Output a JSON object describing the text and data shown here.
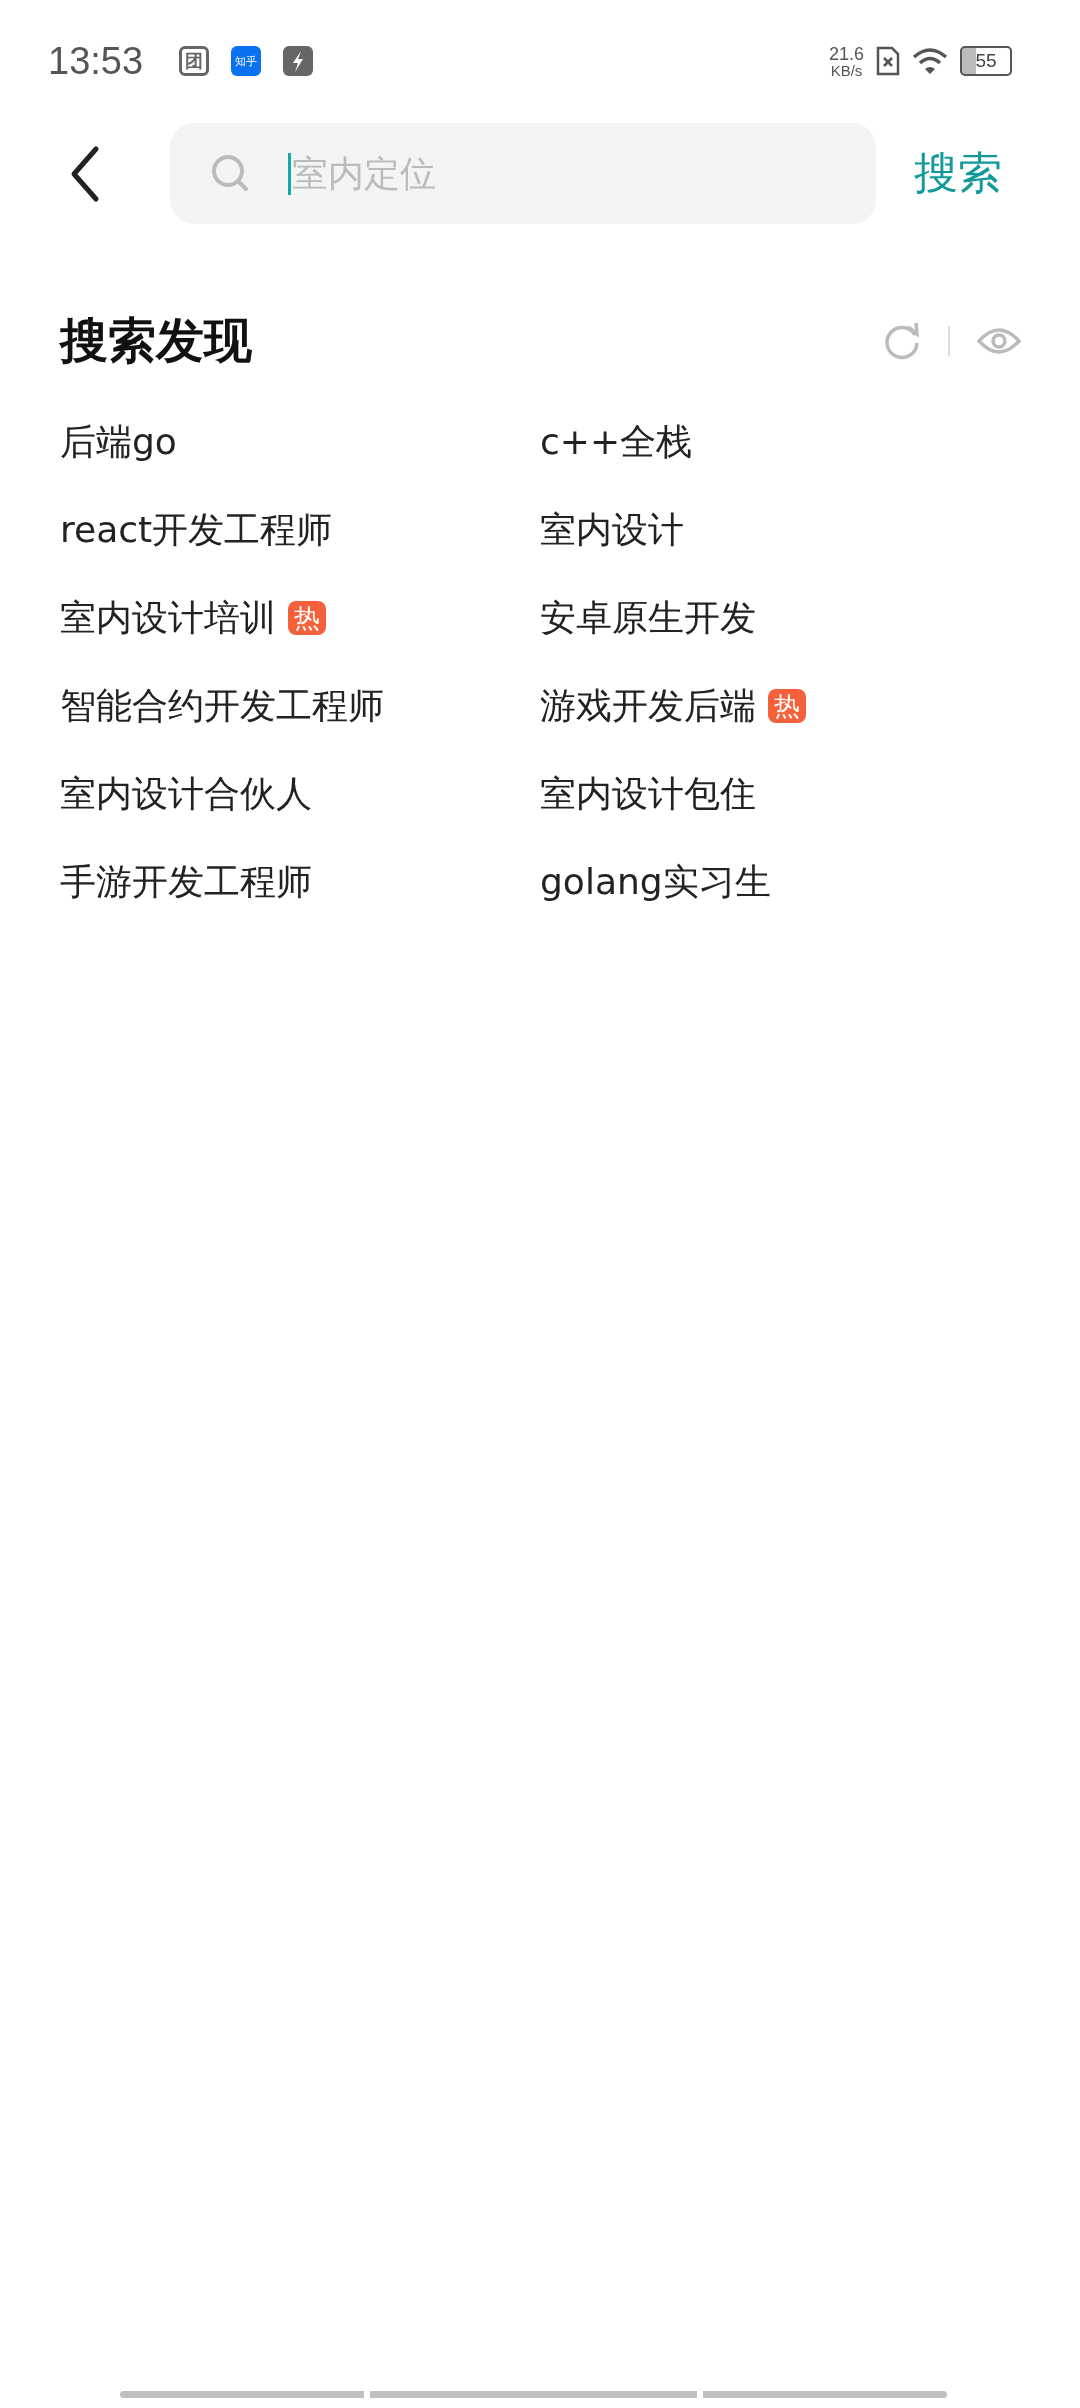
{
  "status_bar": {
    "time": "13:53",
    "app_icons": [
      {
        "kind": "glyph",
        "label": "团"
      },
      {
        "kind": "brand",
        "label": "知乎"
      },
      {
        "kind": "bolt"
      }
    ],
    "net_speed": "21.6",
    "net_unit": "KB/s",
    "battery": "55"
  },
  "search": {
    "placeholder": "室内定位",
    "button": "搜索"
  },
  "discover": {
    "title": "搜索发现",
    "items": [
      {
        "label": "后端go",
        "hot": false
      },
      {
        "label": "c++全栈",
        "hot": false
      },
      {
        "label": "react开发工程师",
        "hot": false
      },
      {
        "label": "室内设计",
        "hot": false
      },
      {
        "label": "室内设计培训",
        "hot": true,
        "badge": "热"
      },
      {
        "label": "安卓原生开发",
        "hot": false
      },
      {
        "label": "智能合约开发工程师",
        "hot": false
      },
      {
        "label": "游戏开发后端",
        "hot": true,
        "badge": "热"
      },
      {
        "label": "室内设计合伙人",
        "hot": false
      },
      {
        "label": "室内设计包住",
        "hot": false
      },
      {
        "label": "手游开发工程师",
        "hot": false
      },
      {
        "label": "golang实习生",
        "hot": false
      }
    ]
  }
}
